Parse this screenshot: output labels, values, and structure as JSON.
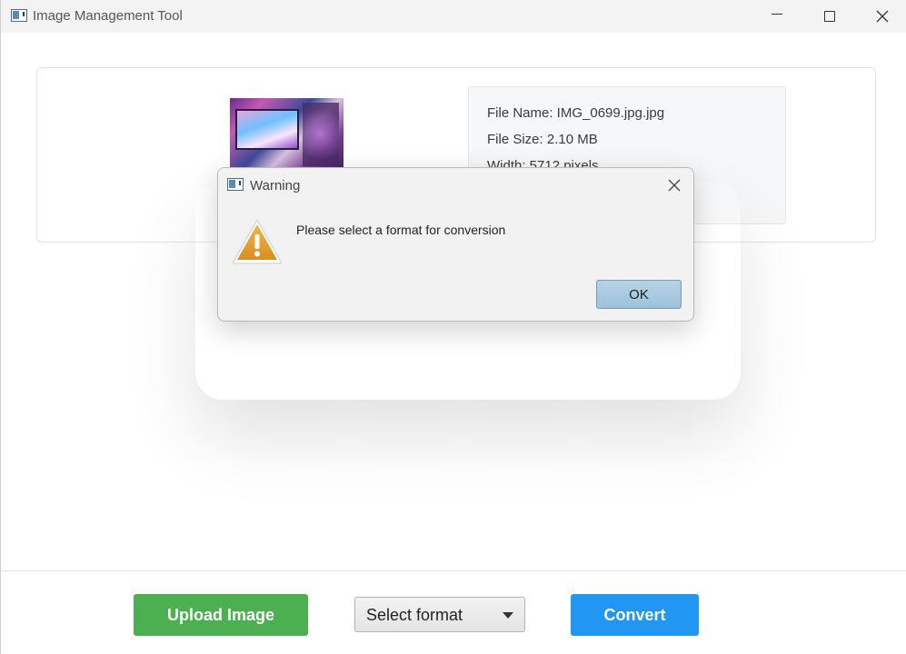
{
  "window": {
    "title": "Image Management Tool",
    "controls": {
      "minimize": "minimize-icon",
      "maximize": "maximize-icon",
      "close": "close-icon"
    }
  },
  "file_info": {
    "name_line": "File Name: IMG_0699.jpg.jpg",
    "size_line": "File Size: 2.10 MB",
    "width_line": "Width: 5712 pixels"
  },
  "dialog": {
    "title": "Warning",
    "message": "Please select a format for conversion",
    "ok_label": "OK",
    "icon": "warning-icon"
  },
  "toolbar": {
    "upload_label": "Upload Image",
    "format_placeholder": "Select format",
    "convert_label": "Convert"
  },
  "colors": {
    "upload": "#4caf50",
    "convert": "#2196f3",
    "warning": "#e0a030"
  }
}
